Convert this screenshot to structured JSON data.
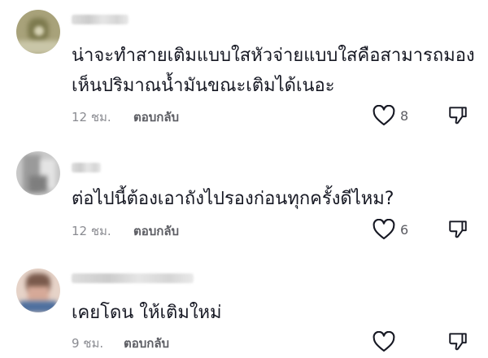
{
  "comments": [
    {
      "text_lines": [
        "น่าจะทำสายเติมแบบใสหัวจ่ายแบบใสคือสามารถมอง",
        "เห็นปริมาณน้ำมันขณะเติมได้เนอะ"
      ],
      "time": "12 ชม.",
      "reply_label": "ตอบกลับ",
      "like_count": "8"
    },
    {
      "text_lines": [
        "ต่อไปนี้ต้องเอาถังไปรองก่อนทุกครั้งดีไหม?"
      ],
      "time": "12 ชม.",
      "reply_label": "ตอบกลับ",
      "like_count": "6"
    },
    {
      "text_lines": [
        "เคยโดน ให้เติมใหม่"
      ],
      "time": "9 ชม.",
      "reply_label": "ตอบกลับ",
      "like_count": ""
    }
  ],
  "icons": {
    "like": "heart-outline-icon",
    "dislike": "thumbs-down-outline-icon"
  },
  "colors": {
    "text": "#161823",
    "meta": "#8a8b91",
    "icon": "#161823"
  }
}
